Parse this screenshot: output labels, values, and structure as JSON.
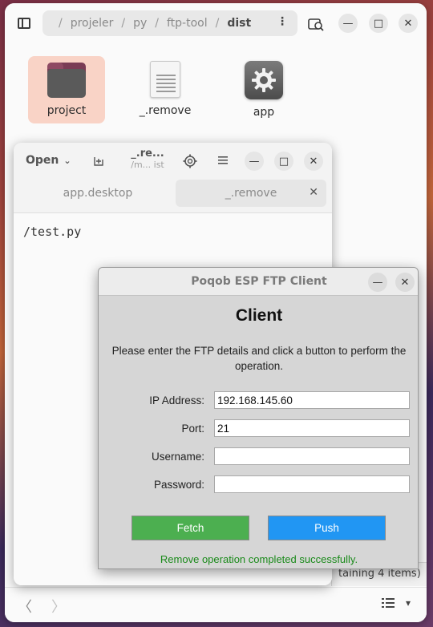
{
  "file_manager": {
    "path": [
      "projeler",
      "py",
      "ftp-tool",
      "dist"
    ],
    "items": [
      {
        "name": "project",
        "icon": "folder-icon",
        "selected": true
      },
      {
        "name": "_.remove",
        "icon": "text-file-icon",
        "selected": false
      },
      {
        "name": "app",
        "icon": "gear-app-icon",
        "selected": false
      }
    ],
    "status_text": "taining 4 items)"
  },
  "editor": {
    "open_label": "Open",
    "title": "_.re...",
    "subtitle": "/m...  ist",
    "tabs": [
      {
        "label": "app.desktop",
        "active": false
      },
      {
        "label": "_.remove",
        "active": true
      }
    ],
    "content": "/test.py"
  },
  "ftp_dialog": {
    "window_title": "Poqob ESP FTP Client",
    "heading": "Client",
    "instructions": "Please enter the FTP details and click a button to perform the operation.",
    "fields": {
      "ip": {
        "label": "IP Address:",
        "value": "192.168.145.60"
      },
      "port": {
        "label": "Port:",
        "value": "21"
      },
      "username": {
        "label": "Username:",
        "value": ""
      },
      "password": {
        "label": "Password:",
        "value": ""
      }
    },
    "buttons": {
      "fetch": "Fetch",
      "push": "Push"
    },
    "status": "Remove operation completed successfully.",
    "colors": {
      "fetch": "#4caf50",
      "push": "#2196f3",
      "status": "#1a8a1a"
    }
  }
}
